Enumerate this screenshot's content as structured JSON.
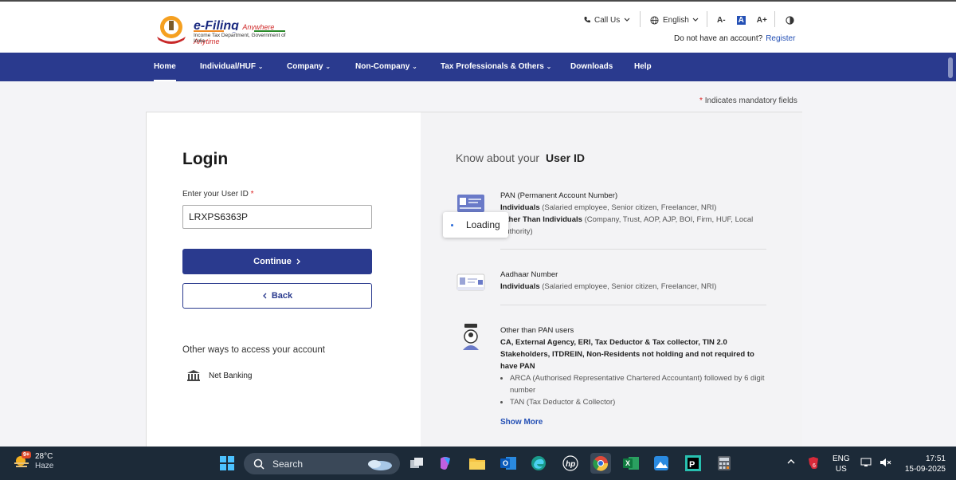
{
  "header": {
    "logo_title": "e-Filing",
    "logo_tagline": "Anywhere Anytime",
    "logo_subtitle": "Income Tax Department, Government of India",
    "call_us": "Call Us",
    "language": "English",
    "font_decrease": "A-",
    "font_normal": "A",
    "font_increase": "A+",
    "no_account": "Do not have an account?",
    "register": "Register"
  },
  "nav": {
    "items": [
      {
        "label": "Home"
      },
      {
        "label": "Individual/HUF"
      },
      {
        "label": "Company"
      },
      {
        "label": "Non-Company"
      },
      {
        "label": "Tax Professionals & Others"
      },
      {
        "label": "Downloads"
      },
      {
        "label": "Help"
      }
    ]
  },
  "mandatory_note": "Indicates mandatory fields",
  "login": {
    "title": "Login",
    "user_id_label": "Enter your User ID",
    "user_id_value": "LRXPS6363P",
    "continue_label": "Continue",
    "back_label": "Back",
    "other_ways": "Other ways to access your account",
    "net_banking": "Net Banking"
  },
  "know": {
    "title_prefix": "Know about your",
    "title_main": "User ID",
    "pan": {
      "title": "PAN (Permanent Account Number)",
      "line1_bold": "Individuals",
      "line1_rest": "(Salaried employee, Senior citizen, Freelancer, NRI)",
      "line2_bold": "Other Than Individuals",
      "line2_rest": "(Company, Trust, AOP, AJP, BOI, Firm, HUF, Local Authority)"
    },
    "aadhaar": {
      "title": "Aadhaar Number",
      "line1_bold": "Individuals",
      "line1_rest": "(Salaried employee, Senior citizen, Freelancer, NRI)"
    },
    "other": {
      "title": "Other than PAN users",
      "bold": "CA, External Agency, ERI, Tax Deductor & Tax collector, TIN 2.0 Stakeholders, ITDREIN, Non-Residents not holding and not required to have PAN",
      "bullet1": "ARCA (Authorised Representative Chartered Accountant) followed by 6 digit number",
      "bullet2": "TAN (Tax Deductor & Collector)"
    },
    "show_more": "Show More"
  },
  "loading_label": "Loading",
  "taskbar": {
    "weather_temp": "28°C",
    "weather_desc": "Haze",
    "weather_badge": "9+",
    "search_placeholder": "Search",
    "lang_top": "ENG",
    "lang_bottom": "US",
    "notify_count": "6",
    "time": "17:51",
    "date": "15-09-2025"
  }
}
